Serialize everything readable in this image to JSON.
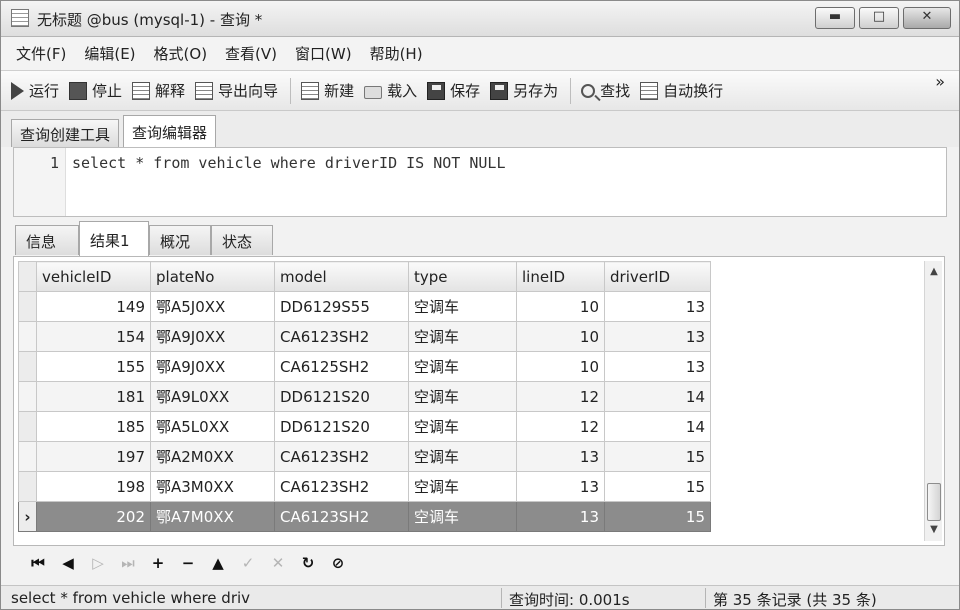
{
  "window": {
    "title": "无标题 @bus (mysql-1) - 查询 *",
    "controls": {
      "minimize": "▬",
      "maximize": "□",
      "close": "✕"
    }
  },
  "menu": [
    "文件(F)",
    "编辑(E)",
    "格式(O)",
    "查看(V)",
    "窗口(W)",
    "帮助(H)"
  ],
  "toolbar": {
    "run": "运行",
    "stop": "停止",
    "explain": "解释",
    "export_wizard": "导出向导",
    "new": "新建",
    "load": "载入",
    "save": "保存",
    "save_as": "另存为",
    "find": "查找",
    "word_wrap": "自动换行",
    "more": "»"
  },
  "editor_tabs": [
    "查询创建工具",
    "查询编辑器"
  ],
  "editor": {
    "line_number": "1",
    "sql": "select * from vehicle where driverID IS NOT NULL"
  },
  "result_tabs": [
    "信息",
    "结果1",
    "概况",
    "状态"
  ],
  "grid": {
    "columns": [
      "vehicleID",
      "plateNo",
      "model",
      "type",
      "lineID",
      "driverID"
    ],
    "rows": [
      [
        "149",
        "鄂A5J0XX",
        "DD6129S55",
        "空调车",
        "10",
        "13"
      ],
      [
        "154",
        "鄂A9J0XX",
        "CA6123SH2",
        "空调车",
        "10",
        "13"
      ],
      [
        "155",
        "鄂A9J0XX",
        "CA6125SH2",
        "空调车",
        "10",
        "13"
      ],
      [
        "181",
        "鄂A9L0XX",
        "DD6121S20",
        "空调车",
        "12",
        "14"
      ],
      [
        "185",
        "鄂A5L0XX",
        "DD6121S20",
        "空调车",
        "12",
        "14"
      ],
      [
        "197",
        "鄂A2M0XX",
        "CA6123SH2",
        "空调车",
        "13",
        "15"
      ],
      [
        "198",
        "鄂A3M0XX",
        "CA6123SH2",
        "空调车",
        "13",
        "15"
      ],
      [
        "202",
        "鄂A7M0XX",
        "CA6123SH2",
        "空调车",
        "13",
        "15"
      ]
    ],
    "selected_marker": "›"
  },
  "navigator": [
    "⏮",
    "◀",
    "▷",
    "⏭",
    "+",
    "−",
    "▲",
    "✓",
    "✕",
    "↻",
    "⊘"
  ],
  "status": {
    "sql": "select * from vehicle where driv",
    "query_time": "查询时间: 0.001s",
    "records": "第 35 条记录 (共 35 条)"
  }
}
